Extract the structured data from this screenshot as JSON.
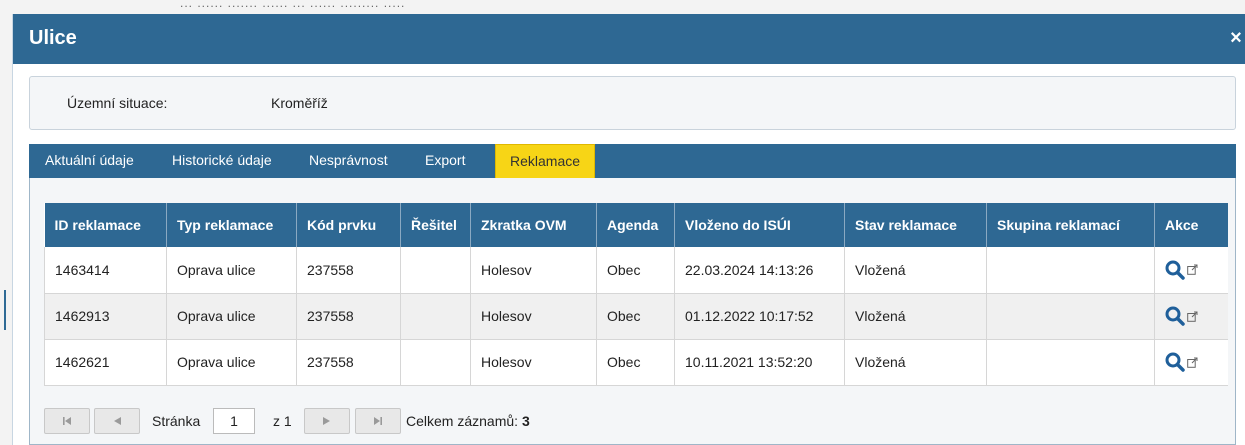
{
  "window": {
    "title": "Ulice",
    "close_glyph": "×"
  },
  "background": {
    "partial_text": "... ...... ....... ......      ... ...... ......... ....."
  },
  "territory": {
    "label": "Územní situace:",
    "value": "Kroměříž"
  },
  "tabs": [
    {
      "label": "Aktuální údaje",
      "active": false
    },
    {
      "label": "Historické údaje",
      "active": false
    },
    {
      "label": "Nesprávnost",
      "active": false
    },
    {
      "label": "Export",
      "active": false
    },
    {
      "label": "Reklamace",
      "active": true
    }
  ],
  "table": {
    "headers": [
      "ID reklamace",
      "Typ reklamace",
      "Kód prvku",
      "Řešitel",
      "Zkratka OVM",
      "Agenda",
      "Vloženo do ISÚI",
      "Stav reklamace",
      "Skupina reklamací",
      "Akce"
    ],
    "rows": [
      {
        "id": "1463414",
        "type": "Oprava ulice",
        "code": "237558",
        "solver": "",
        "ovm": "Holesov",
        "agenda": "Obec",
        "inserted": "22.03.2024 14:13:26",
        "state": "Vložená",
        "group": ""
      },
      {
        "id": "1462913",
        "type": "Oprava ulice",
        "code": "237558",
        "solver": "",
        "ovm": "Holesov",
        "agenda": "Obec",
        "inserted": "01.12.2022 10:17:52",
        "state": "Vložená",
        "group": ""
      },
      {
        "id": "1462621",
        "type": "Oprava ulice",
        "code": "237558",
        "solver": "",
        "ovm": "Holesov",
        "agenda": "Obec",
        "inserted": "10.11.2021 13:52:20",
        "state": "Vložená",
        "group": ""
      }
    ],
    "action_icons": [
      "search-icon",
      "external-link-icon"
    ]
  },
  "pager": {
    "page_label": "Stránka",
    "page_value": "1",
    "of_label": "z 1",
    "total_label": "Celkem záznamů:",
    "total_value": "3"
  },
  "colors": {
    "header_blue": "#2e6893",
    "active_tab": "#f7d516",
    "icon_blue": "#1f5f9a"
  }
}
